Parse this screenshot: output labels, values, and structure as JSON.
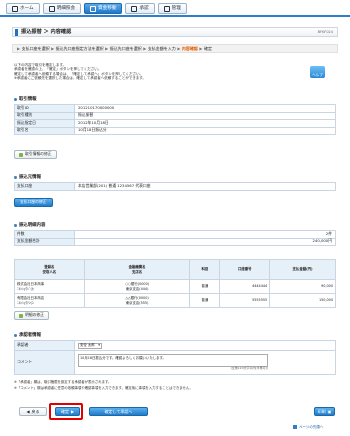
{
  "nav": {
    "tabs": [
      {
        "label": "ホーム",
        "icon": "home-icon"
      },
      {
        "label": "明細照会",
        "icon": "document-icon"
      },
      {
        "label": "資金移動",
        "icon": "transfer-icon"
      },
      {
        "label": "承認",
        "icon": "check-icon"
      },
      {
        "label": "管理",
        "icon": "gear-icon"
      }
    ],
    "active_index": 2
  },
  "page": {
    "title": "振込振替 ＞ 内容確認",
    "screen_id": "BFKF024",
    "steps": [
      "支払口座を選択",
      "振込先口座指定方法を選択",
      "振込先口座を選択",
      "支払金額を入力",
      "内容確認",
      "確定"
    ],
    "current_step": 4,
    "intro_lines": [
      "以下の内容で取引を確定します。",
      "承認者を確認の上、「確定」ボタンを押してください。",
      "確定して承認者へ依頼する場合は、「確定して承認へ」ボタンを押してください。",
      "※承認者にご依頼先を選択した場合は、確定して承認者へ依頼することができます。"
    ],
    "help_label": "ヘルプ"
  },
  "transaction_info": {
    "title": "取引情報",
    "rows": [
      {
        "label": "取引ID",
        "value": "201210170000000"
      },
      {
        "label": "取引種別",
        "value": "振込振替"
      },
      {
        "label": "振込指定日",
        "value": "2012年10月18日"
      },
      {
        "label": "取引名",
        "value": "10月18日振込分"
      }
    ],
    "edit_label": "取引情報の修正"
  },
  "payment_account": {
    "title": "振込元情報",
    "rows": [
      {
        "label": "支払口座",
        "value": "本店営業部(201) 普通 1234567 代表口座"
      }
    ],
    "edit_label": "支払口座の修正"
  },
  "details": {
    "title": "振込明細内容",
    "summary": [
      {
        "label": "件数",
        "value": "2件"
      },
      {
        "label": "支払金額合計",
        "value": "240,000円"
      }
    ],
    "headers": [
      "登録名\n受取人名",
      "金融機関名\n支店名",
      "科目",
      "口座番号",
      "支払金額(円)"
    ],
    "rows": [
      {
        "name1": "株式会社日本商事",
        "name2": "ﾆﾎﾝｼｮｳｼﾞ(ｶ",
        "bank1": "○○銀行(0000)",
        "bank2": "東京支店(444)",
        "type": "普通",
        "account": "4444444",
        "amount": "90,000"
      },
      {
        "name1": "有限会社日本商店",
        "name2": "ﾆﾎﾝｼｮｳﾃﾝ(ﾕ",
        "bank1": "△△銀行(0000)",
        "bank2": "東京支店(555)",
        "type": "普通",
        "account": "5555555",
        "amount": "150,000"
      }
    ],
    "edit_label": "明細の修正"
  },
  "approval": {
    "title": "承認者情報",
    "approver_label": "承認者",
    "approver_value": "安全 太郎",
    "comment_label": "コメント",
    "comment_value": "10月18日振込分です。確認よろしくお願いいたします。",
    "comment_count": "(全角120文字以内[半角可])"
  },
  "notes": [
    "※「承認者」欄は、取引権限を設定する承認者が表示されます。",
    "※「コメント」欄は承認者に任意の依頼事項や確認事項を入力できます。確定後に事項を入力することはできません。"
  ],
  "buttons": {
    "back": "戻る",
    "confirm": "確定",
    "confirm_approve": "確定して承認へ",
    "print": "印刷"
  },
  "footer": {
    "page_top": "ページの先頭へ"
  }
}
